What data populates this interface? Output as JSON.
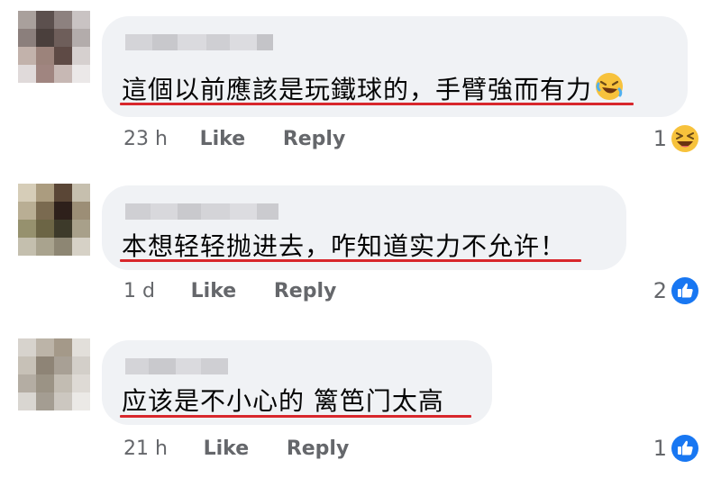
{
  "comments": [
    {
      "text": "這個以前應該是玩鐵球的，手臂強而有力",
      "time": "23 h",
      "like_label": "Like",
      "reply_label": "Reply",
      "reaction_count": "1",
      "reaction_icon": "laughing-emoji-icon",
      "inline_emoji": "rofl-emoji-icon"
    },
    {
      "text": "本想轻轻抛进去，咋知道实力不允许！",
      "time": "1 d",
      "like_label": "Like",
      "reply_label": "Reply",
      "reaction_count": "2",
      "reaction_icon": "like-thumb-icon"
    },
    {
      "text": "应该是不小心的 篱笆门太高",
      "time": "21 h",
      "like_label": "Like",
      "reply_label": "Reply",
      "reaction_count": "1",
      "reaction_icon": "like-thumb-icon"
    }
  ],
  "colors": {
    "bubble": "#f0f2f5",
    "underline": "#d8272c",
    "meta_text": "#65676b",
    "like_blue": "#1877f2"
  }
}
